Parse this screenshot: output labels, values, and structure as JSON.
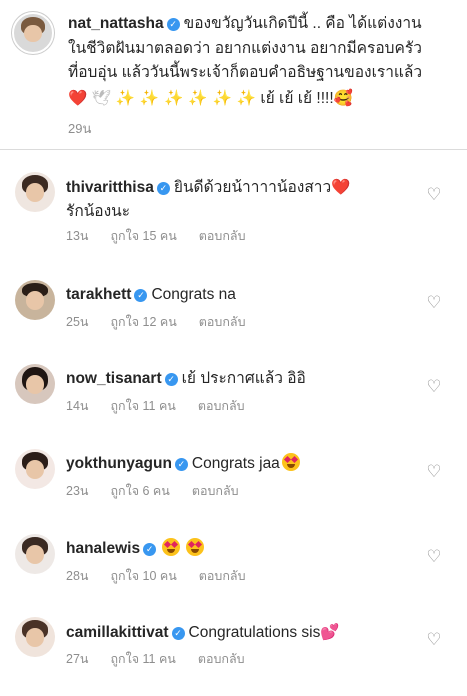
{
  "caption": {
    "username": "nat_nattasha",
    "verified_glyph": "✓",
    "text_line1": "ของขวัญวันเกิดปีนี้ .. คือ ได้แต่งงาน",
    "text_line2": "ในชีวิตฝันมาตลอดว่า อยากแต่งงาน อยากมีครอบครัว",
    "text_line3": "ที่อบอุ่น แล้ววันนี้พระเจ้าก็ตอบคำอธิษฐานของเราแล้ว",
    "emoji_heart": "❤️",
    "emoji_dove": "🕊",
    "emoji_sparkles": "✨ ✨ ✨ ✨ ✨ ✨",
    "text_tail": "เย้ เย้ เย้ !!!!",
    "emoji_blush": "🥰",
    "time": "29น"
  },
  "comments": [
    {
      "username": "thivaritthisa",
      "text": "ยินดีด้วยน้าาาาน้องสาว",
      "emoji": "❤️",
      "text_line2": "รักน้องนะ",
      "time": "13น",
      "likes": "ถูกใจ 15 คน",
      "reply": "ตอบกลับ",
      "like_icon": "♡"
    },
    {
      "username": "tarakhett",
      "text": "Congrats na",
      "time": "25น",
      "likes": "ถูกใจ 12 คน",
      "reply": "ตอบกลับ",
      "like_icon": "♡"
    },
    {
      "username": "now_tisanart",
      "text": "เย้ ประกาศแล้ว อิอิ",
      "time": "14น",
      "likes": "ถูกใจ 11 คน",
      "reply": "ตอบกลับ",
      "like_icon": "♡"
    },
    {
      "username": "yokthunyagun",
      "text": "Congrats jaa",
      "time": "23น",
      "likes": "ถูกใจ 6 คน",
      "reply": "ตอบกลับ",
      "like_icon": "♡"
    },
    {
      "username": "hanalewis",
      "text": "",
      "time": "28น",
      "likes": "ถูกใจ 10 คน",
      "reply": "ตอบกลับ",
      "like_icon": "♡"
    },
    {
      "username": "camillakittivat",
      "text": "Congratulations sis",
      "emoji": "💕",
      "time": "27น",
      "likes": "ถูกใจ 11 คน",
      "reply": "ตอบกลับ",
      "like_icon": "♡"
    }
  ],
  "colors": {
    "text": "#262626",
    "secondary": "#8e8e8e",
    "verified": "#3897f0",
    "divider": "#dbdbdb"
  }
}
